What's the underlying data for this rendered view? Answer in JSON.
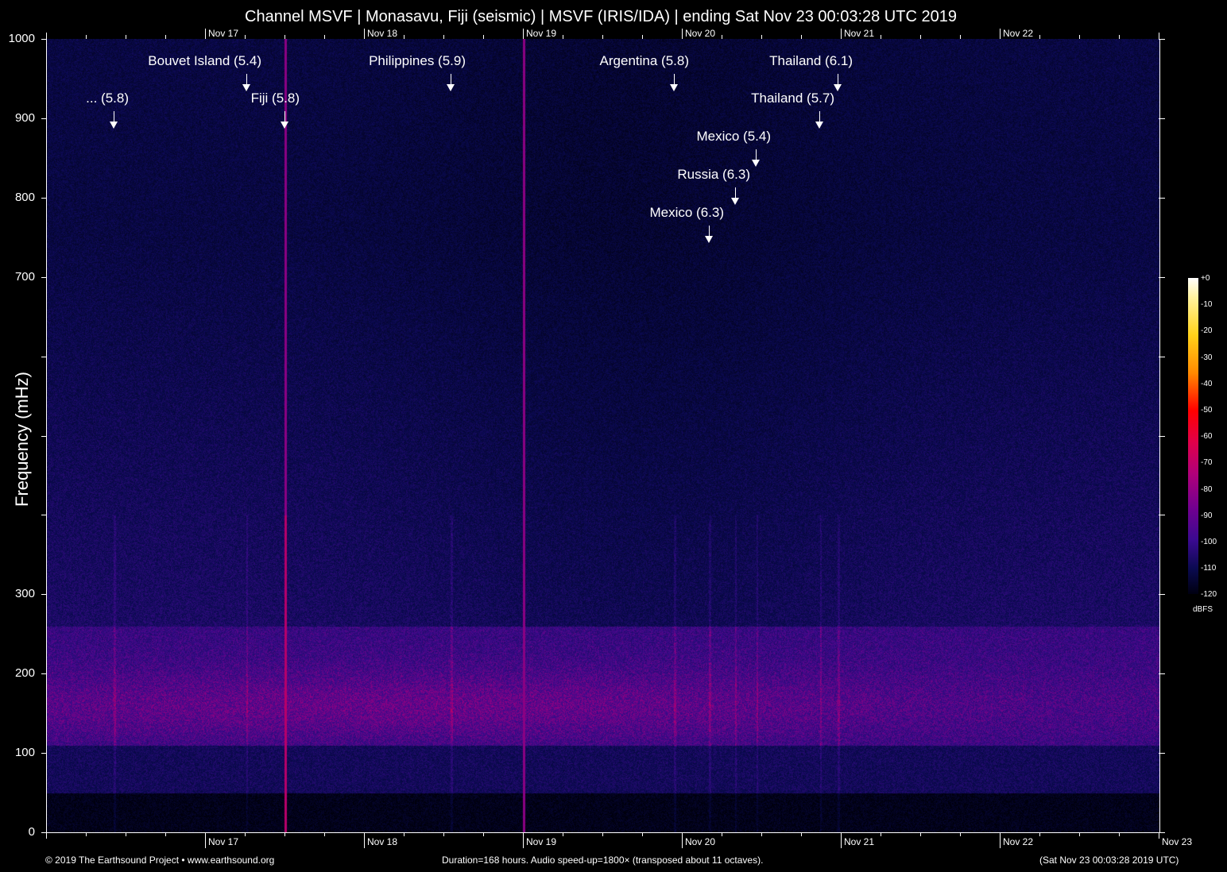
{
  "title": "Channel MSVF | Monasavu, Fiji (seismic) | MSVF (IRIS/IDA) | ending Sat Nov 23 00:03:28 UTC 2019",
  "footer": {
    "left": "© 2019 The Earthsound Project • www.earthsound.org",
    "center": "Duration=168 hours. Audio speed-up=1800× (transposed about 11 octaves).",
    "right": "(Sat Nov 23 00:03:28 2019 UTC)"
  },
  "chart_data": {
    "type": "heatmap",
    "title": "Channel MSVF | Monasavu, Fiji (seismic) | MSVF (IRIS/IDA) | ending Sat Nov 23 00:03:28 UTC 2019",
    "ylabel": "Frequency (mHz)",
    "xlabel": "",
    "ylim": [
      0,
      1000
    ],
    "xlim_hours": [
      0,
      168
    ],
    "y_ticks": [
      0,
      100,
      200,
      300,
      400,
      500,
      600,
      700,
      800,
      900,
      1000
    ],
    "y_tick_labels": [
      "0",
      "100",
      "200",
      "300",
      "",
      "",
      "",
      "700",
      "800",
      "900",
      "1000"
    ],
    "x_ticks": [
      {
        "label": "Nov 17",
        "hour": 24
      },
      {
        "label": "Nov 18",
        "hour": 48
      },
      {
        "label": "Nov 19",
        "hour": 72
      },
      {
        "label": "Nov 20",
        "hour": 96
      },
      {
        "label": "Nov 21",
        "hour": 120
      },
      {
        "label": "Nov 22",
        "hour": 144
      }
    ],
    "x_end_label": "Nov 23",
    "colorbar": {
      "unit": "dBFS",
      "range": [
        -120,
        0
      ],
      "ticks": [
        "+0",
        "-10",
        "-20",
        "-30",
        "-40",
        "-50",
        "-60",
        "-70",
        "-80",
        "-90",
        "-100",
        "-110",
        "-120"
      ]
    },
    "events": [
      {
        "label": "... (5.8)",
        "hour": 10.2,
        "freq": 887
      },
      {
        "label": "Bouvet Island (5.4)",
        "hour": 30.2,
        "freq": 934
      },
      {
        "label": "Fiji (5.8)",
        "hour": 36.0,
        "freq": 887
      },
      {
        "label": "Philippines (5.9)",
        "hour": 61.1,
        "freq": 934
      },
      {
        "label": "Argentina (5.8)",
        "hour": 94.8,
        "freq": 934
      },
      {
        "label": "Mexico (6.3)",
        "hour": 100.1,
        "freq": 743
      },
      {
        "label": "Russia (6.3)",
        "hour": 104.0,
        "freq": 791
      },
      {
        "label": "Mexico (5.4)",
        "hour": 107.2,
        "freq": 839
      },
      {
        "label": "Thailand (5.7)",
        "hour": 116.8,
        "freq": 887
      },
      {
        "label": "Thailand (6.1)",
        "hour": 119.5,
        "freq": 934
      }
    ],
    "energy_band_mHz": [
      100,
      250
    ],
    "strong_lines_hours": [
      36.0,
      72.0
    ]
  }
}
